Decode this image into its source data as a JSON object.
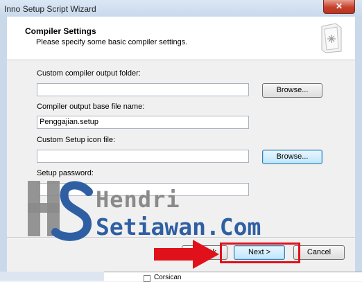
{
  "window": {
    "title": "Inno Setup Script Wizard",
    "close_glyph": "✕"
  },
  "header": {
    "title": "Compiler Settings",
    "subtitle": "Please specify some basic compiler settings.",
    "icon": "wizard-page-icon"
  },
  "fields": {
    "output_folder": {
      "label": "Custom compiler output folder:",
      "value": ""
    },
    "base_file_name": {
      "label": "Compiler output base file name:",
      "value": "Penggajian.setup"
    },
    "icon_file": {
      "label": "Custom Setup icon file:",
      "value": ""
    },
    "password": {
      "label": "Setup password:",
      "value": ""
    }
  },
  "buttons": {
    "browse_label": "Browse...",
    "back_label": "< Back",
    "next_label": "Next >",
    "cancel_label": "Cancel"
  },
  "watermark": {
    "name": "Hendri",
    "site": "Setiawan.Com",
    "colors": {
      "gray": "#8a8a8a",
      "blue": "#2f5fa3"
    }
  },
  "annotation": {
    "color": "#e0111b"
  },
  "background_window": {
    "item_label": "Corsican"
  }
}
